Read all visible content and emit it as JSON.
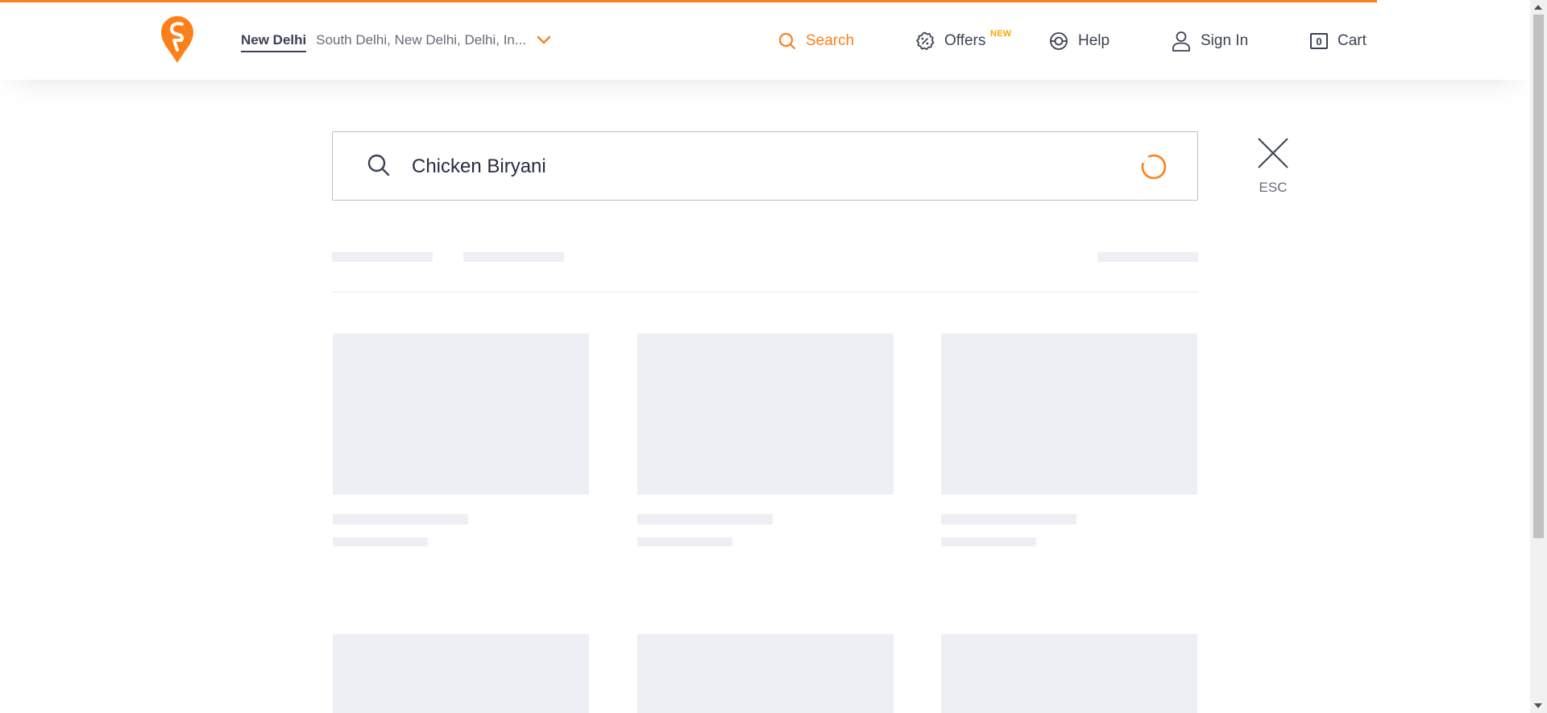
{
  "header": {
    "location": {
      "city": "New Delhi",
      "address": "South Delhi, New Delhi, Delhi, In..."
    },
    "nav": {
      "search": "Search",
      "offers": "Offers",
      "offers_badge": "NEW",
      "help": "Help",
      "sign_in": "Sign In",
      "cart_count": "0",
      "cart": "Cart"
    }
  },
  "search": {
    "value": "Chicken Biryani",
    "esc_label": "ESC"
  },
  "colors": {
    "brand": "#fc8019",
    "badge": "#ffa700",
    "text": "#3d4152",
    "skeleton": "#eeeff4"
  },
  "icons": [
    "swiggy-logo",
    "chevron-down-icon",
    "search-icon",
    "offers-icon",
    "help-icon",
    "user-icon",
    "cart-icon",
    "close-icon",
    "loading-spinner"
  ]
}
